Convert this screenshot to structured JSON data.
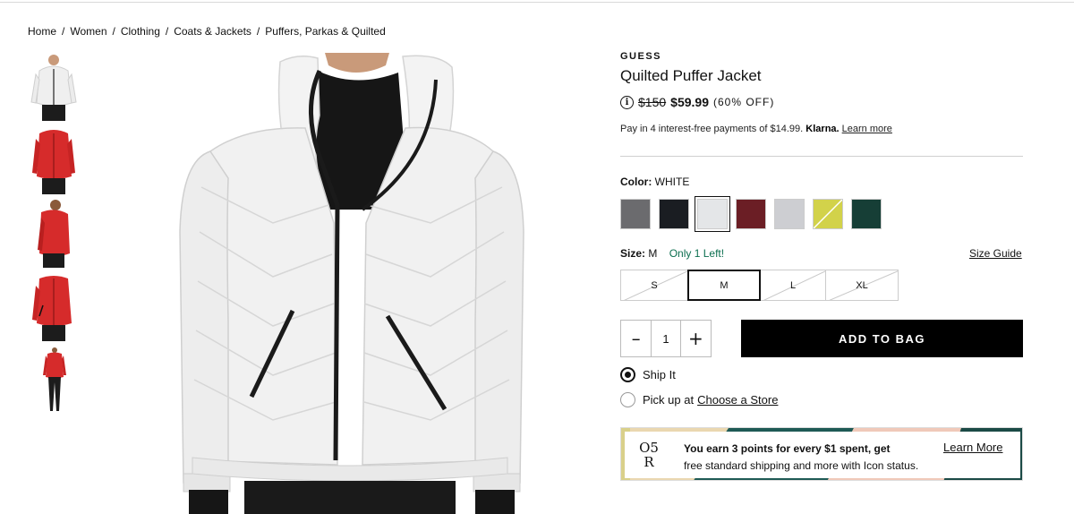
{
  "breadcrumb": [
    "Home",
    "Women",
    "Clothing",
    "Coats & Jackets",
    "Puffers, Parkas & Quilted"
  ],
  "breadcrumb_separator": "/",
  "thumbnails": [
    {
      "name": "white jacket front",
      "color": "#f2f2f2"
    },
    {
      "name": "red jacket front",
      "color": "#d62b2b"
    },
    {
      "name": "red jacket side",
      "color": "#d62b2b"
    },
    {
      "name": "red jacket angle",
      "color": "#d62b2b"
    },
    {
      "name": "red jacket full body",
      "color": "#d62b2b"
    }
  ],
  "product": {
    "brand": "GUESS",
    "title": "Quilted Puffer Jacket",
    "original_price": "$150",
    "sale_price": "$59.99",
    "discount": "(60% OFF)",
    "info_icon_glyph": "i",
    "klarna_text": "Pay in 4 interest-free payments of $14.99.",
    "klarna_brand": "Klarna.",
    "klarna_learn": "Learn more"
  },
  "color": {
    "label": "Color:",
    "selected": "WHITE",
    "swatches": [
      {
        "name": "gray",
        "hex": "#6b6b6e"
      },
      {
        "name": "black",
        "hex": "#1a1d22"
      },
      {
        "name": "white",
        "hex": "#e4e6e8",
        "selected": true
      },
      {
        "name": "burgundy",
        "hex": "#6b1e25"
      },
      {
        "name": "silver",
        "hex": "#cdced2"
      },
      {
        "name": "lime",
        "hex": "#d2d24a",
        "unavailable": true
      },
      {
        "name": "forest green",
        "hex": "#163e36"
      }
    ]
  },
  "size": {
    "label": "Size:",
    "selected": "M",
    "stock_note": "Only 1 Left!",
    "guide_label": "Size Guide",
    "options": [
      {
        "label": "S",
        "unavailable": true
      },
      {
        "label": "M",
        "selected": true
      },
      {
        "label": "L",
        "unavailable": true
      },
      {
        "label": "XL",
        "unavailable": true
      }
    ]
  },
  "quantity": {
    "minus": "–",
    "value": "1",
    "plus": "+"
  },
  "add_to_bag": "ADD TO BAG",
  "fulfillment": {
    "ship_label": "Ship It",
    "pickup_label": "Pick up at",
    "pickup_link": "Choose a Store"
  },
  "rewards": {
    "logo_top": "O5",
    "logo_bottom": "R",
    "line1": "You earn 3 points for every $1 spent, get",
    "line2": "free standard shipping and more with Icon status.",
    "learn_more": "Learn More"
  },
  "colors": {
    "accent_green": "#0b6e4f",
    "button_black": "#000000"
  }
}
